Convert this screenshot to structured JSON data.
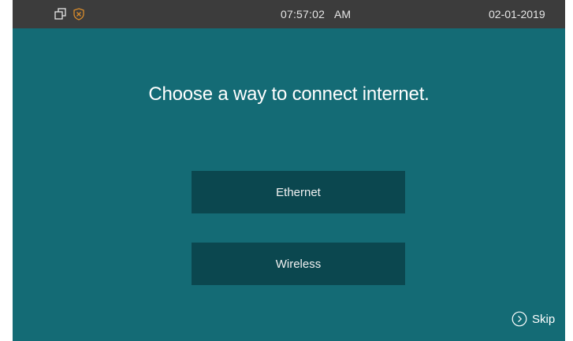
{
  "status_bar": {
    "time": "07:57:02",
    "ampm": "AM",
    "date": "02-01-2019",
    "icons": [
      "windows-icon",
      "shield-icon"
    ]
  },
  "main": {
    "title": "Choose a way to connect internet.",
    "options": [
      {
        "label": "Ethernet"
      },
      {
        "label": "Wireless"
      }
    ],
    "skip_label": "Skip"
  },
  "colors": {
    "background": "#146b75",
    "status_bar": "#3c3c3c",
    "button": "#0b474f",
    "shield_accent": "#d98c2b"
  }
}
